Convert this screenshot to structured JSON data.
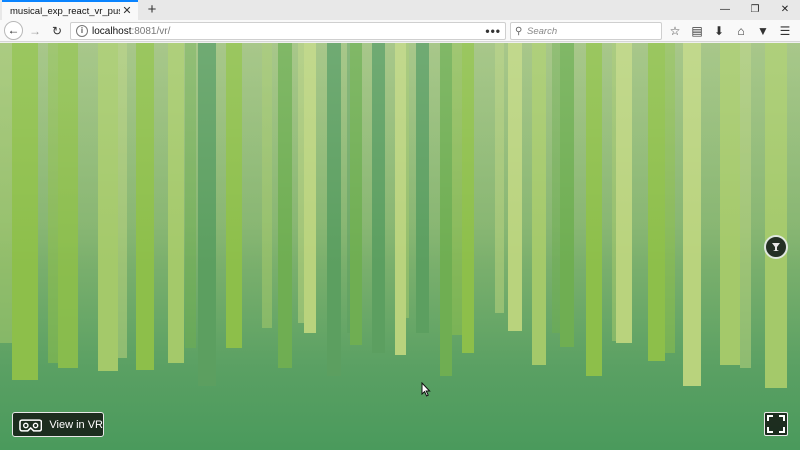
{
  "browser": {
    "tab": {
      "title": "musical_exp_react_vr_pusher",
      "close_icon": "close-icon"
    },
    "new_tab_icon": "plus-icon",
    "window_controls": [
      "minimize-icon",
      "restore-icon",
      "close-icon"
    ],
    "nav": {
      "back_icon": "arrow-left-icon",
      "forward_icon": "arrow-right-icon",
      "reload_icon": "reload-icon"
    },
    "url": {
      "host": "localhost",
      "path": ":8081/vr/",
      "info_icon": "info-icon",
      "actions_icon": "ellipsis-icon"
    },
    "search": {
      "placeholder": "Search",
      "icon": "search-icon"
    },
    "toolbar_icons": [
      "star-icon",
      "reader-icon",
      "download-icon",
      "home-icon",
      "pocket-icon",
      "hamburger-menu-icon"
    ]
  },
  "vr": {
    "view_in_vr_label": "View in VR",
    "vr_icon": "vr-headset-icon",
    "gaze_button_icon": "cup-icon",
    "fullscreen_icon": "fullscreen-icon",
    "background_color": "#7fb36e",
    "pillar_colors": [
      "#8dbf4a",
      "#a4c96a",
      "#5c9f60",
      "#b9d37d",
      "#6fae52"
    ]
  }
}
